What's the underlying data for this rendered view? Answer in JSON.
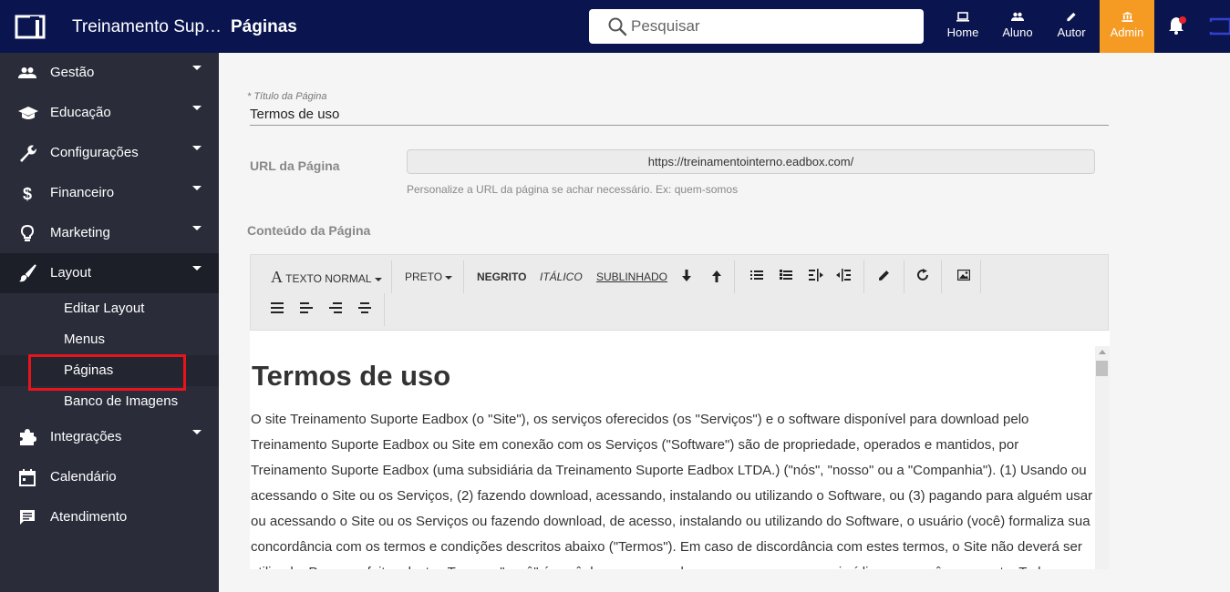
{
  "header": {
    "app_title": "Treinamento Suporte Eadbox",
    "section_title": "Páginas",
    "search_placeholder": "Pesquisar",
    "nav": [
      {
        "label": "Home",
        "icon": "laptop-icon"
      },
      {
        "label": "Aluno",
        "icon": "people-icon"
      },
      {
        "label": "Autor",
        "icon": "pencil-icon"
      },
      {
        "label": "Admin",
        "icon": "bank-icon"
      }
    ],
    "colors": {
      "bar": "#0a1550",
      "admin": "#f59a23",
      "notification": "#e8222a"
    }
  },
  "sidebar": {
    "items": [
      {
        "label": "Gestão",
        "icon": "people-icon"
      },
      {
        "label": "Educação",
        "icon": "graduation-cap-icon"
      },
      {
        "label": "Configurações",
        "icon": "wrench-icon"
      },
      {
        "label": "Financeiro",
        "icon": "dollar-icon"
      },
      {
        "label": "Marketing",
        "icon": "lightbulb-icon"
      },
      {
        "label": "Layout",
        "icon": "brush-icon"
      },
      {
        "label": "Integrações",
        "icon": "puzzle-icon"
      },
      {
        "label": "Calendário",
        "icon": "calendar-icon"
      },
      {
        "label": "Atendimento",
        "icon": "chat-icon"
      }
    ],
    "layout_subitems": [
      "Editar Layout",
      "Menus",
      "Páginas",
      "Banco de Imagens"
    ]
  },
  "form": {
    "title_label": "* Título da Página",
    "title_value": "Termos de uso",
    "url_label": "URL da Página",
    "url_value": "https://treinamentointerno.eadbox.com/",
    "url_help": "Personalize a URL da página se achar necessário. Ex: quem-somos",
    "content_label": "Conteúdo da Página"
  },
  "toolbar": {
    "text_style": "TEXTO NORMAL",
    "color": "PRETO",
    "bold": "NEGRITO",
    "italic": "ITÁLICO",
    "underline": "SUBLINHADO"
  },
  "editor": {
    "heading": "Termos de uso",
    "body": "O site Treinamento Suporte Eadbox (o \"Site\"), os serviços oferecidos (os \"Serviços\") e o software disponível para download pelo Treinamento Suporte Eadbox ou Site em conexão com os Serviços (\"Software\") são de propriedade, operados e mantidos, por Treinamento Suporte Eadbox (uma subsidiária da Treinamento Suporte Eadbox LTDA.) (\"nós\", \"nosso\" ou a \"Companhia\"). (1) Usando ou acessando o Site ou os Serviços, (2) fazendo download, acessando, instalando ou utilizando o Software, ou (3) pagando para alguém usar ou acessando o Site ou os Serviços ou fazendo download, de acesso, instalando ou utilizando do Software, o usuário (você) formaliza sua concordância com os termos e condições descritos abaixo (\"Termos\"). Em caso de discordância com estes termos, o Site não deverá ser utilizado. Para os efeitos destes Termos, \"você\" é você, bem como qualquer empresa ou pessoa jurídica que você represente. Todos (conforme definido"
  }
}
